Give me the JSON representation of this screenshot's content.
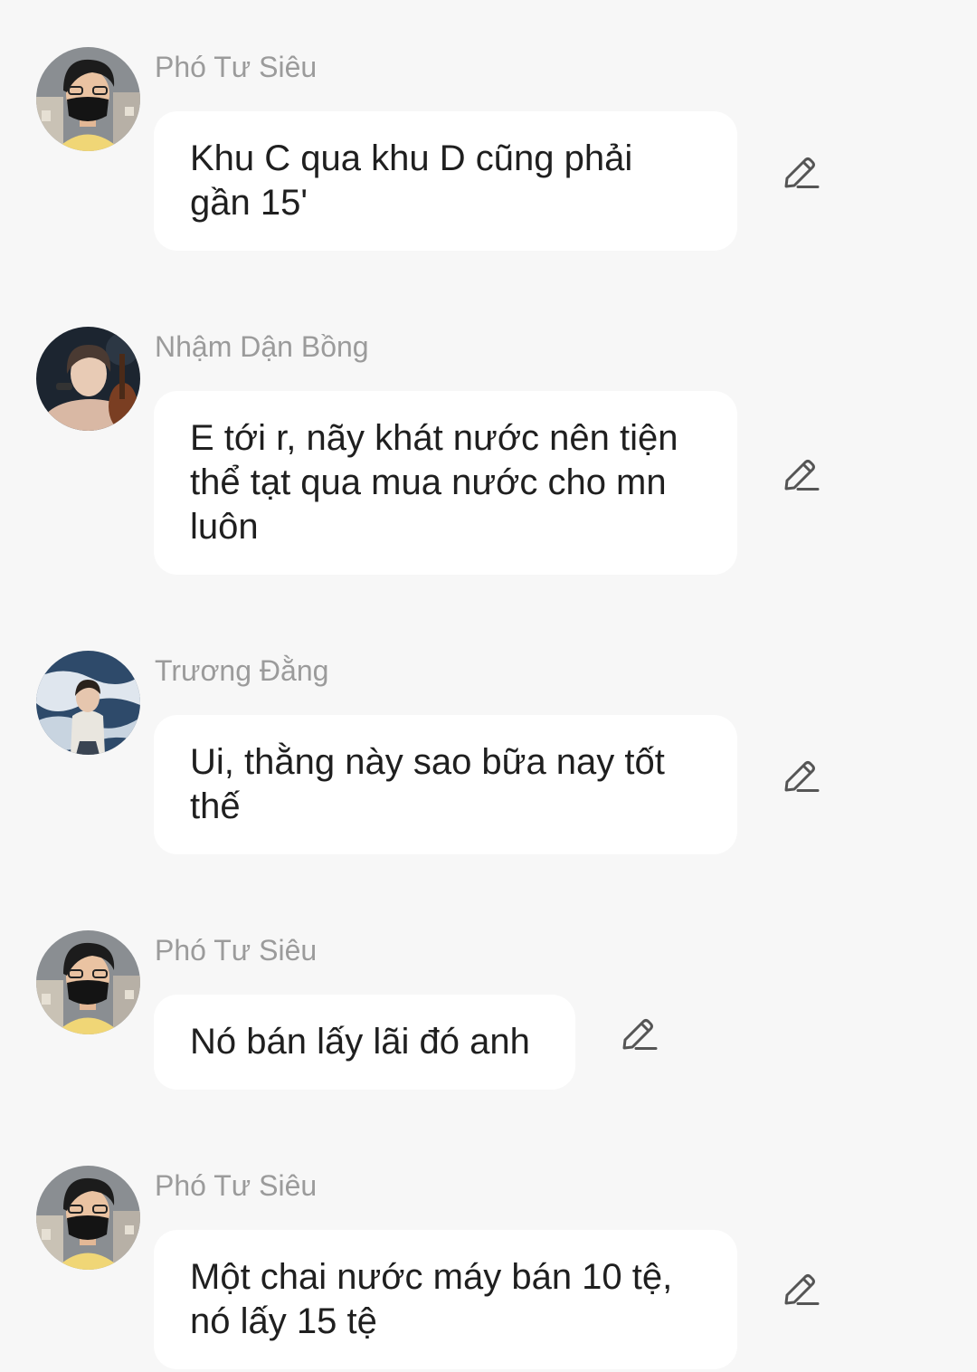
{
  "messages": [
    {
      "sender": "Phó Tư Siêu",
      "text": "Khu C qua khu D cũng phải gần 15'",
      "avatar_icon": "person-masked-avatar"
    },
    {
      "sender": "Nhậm Dận Bồng",
      "text": "E tới r, nãy khát nước nên tiện thể tạt qua mua nước cho mn luôn",
      "avatar_icon": "person-with-guitar-avatar"
    },
    {
      "sender": "Trương Đằng",
      "text": "Ui, thằng này sao bữa nay tốt thế",
      "avatar_icon": "person-at-sea-avatar"
    },
    {
      "sender": "Phó Tư Siêu",
      "text": "Nó bán lấy lãi đó anh",
      "avatar_icon": "person-masked-avatar"
    },
    {
      "sender": "Phó Tư Siêu",
      "text": "Một chai nước máy bán 10 tệ, nó lấy 15 tệ",
      "avatar_icon": "person-masked-avatar"
    }
  ],
  "colors": {
    "background": "#f7f7f7",
    "bubble": "#ffffff",
    "sender_text": "#9b9b9b",
    "message_text": "#1f1f1f",
    "edit_icon": "#555555"
  },
  "icons": {
    "edit": "pencil-edit-icon"
  }
}
